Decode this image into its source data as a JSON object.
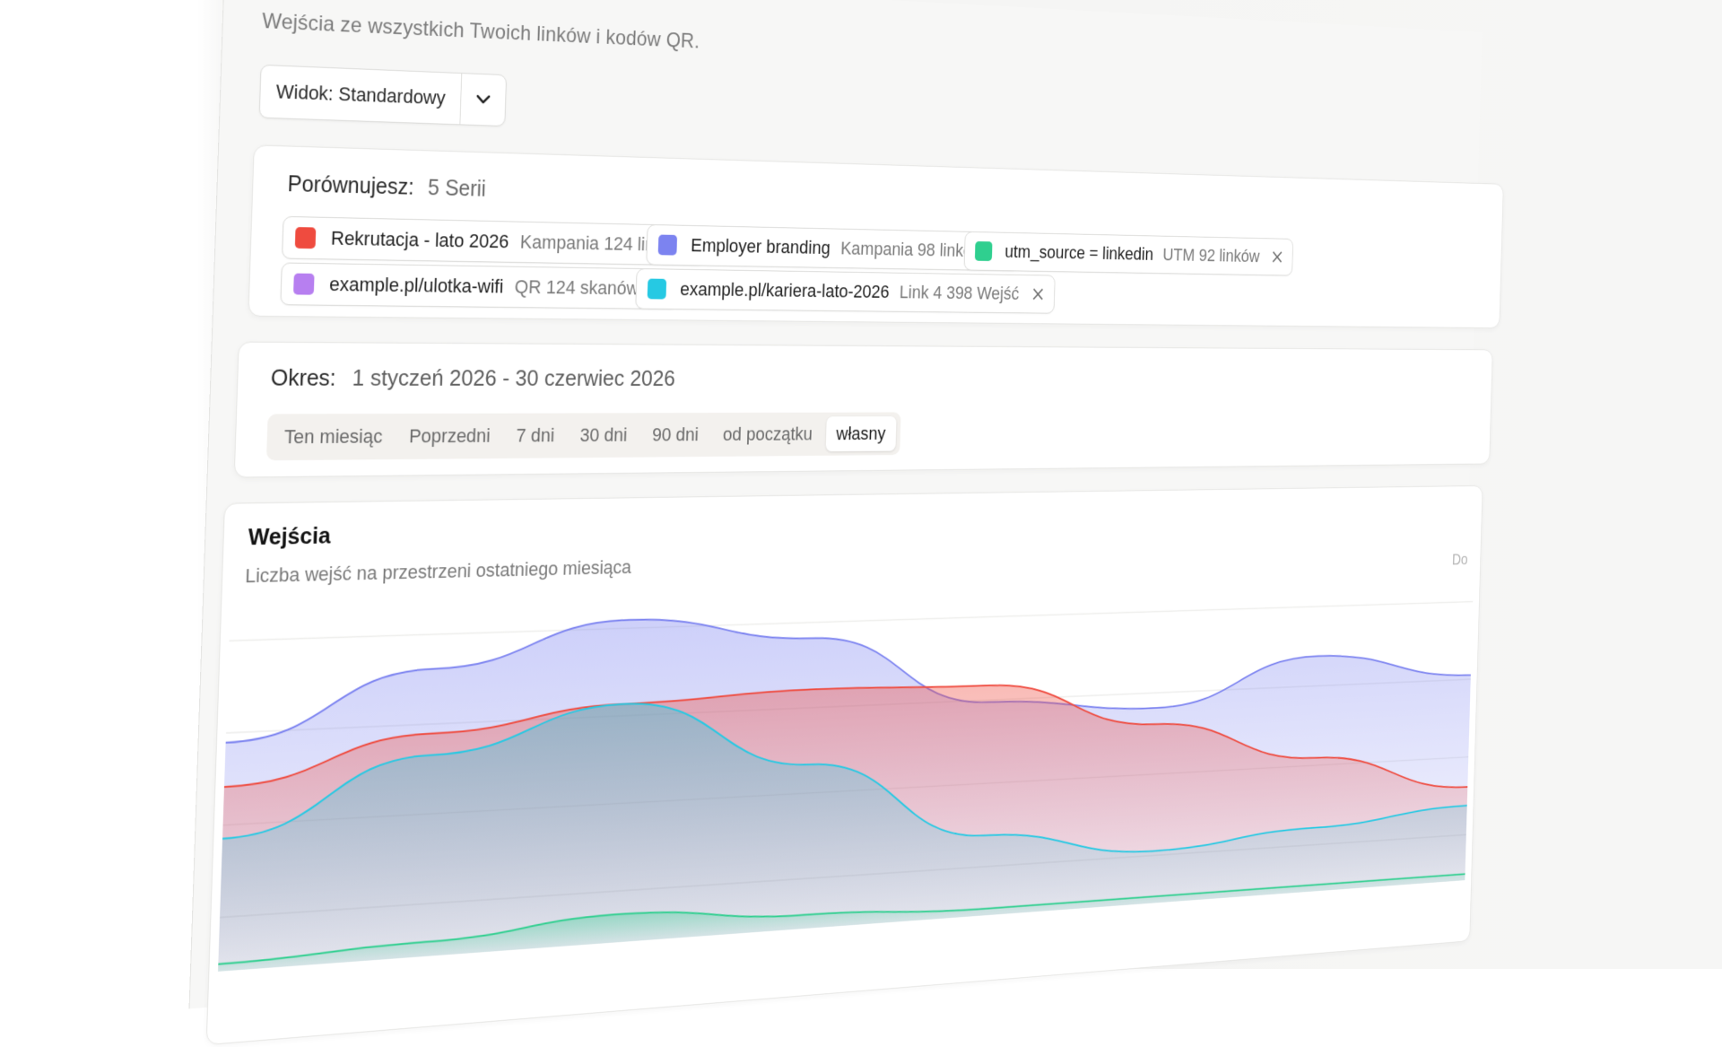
{
  "page": {
    "subtitle": "Wejścia ze wszystkich Twoich linków i kodów QR."
  },
  "view": {
    "label": "Widok: Standardowy",
    "caret_icon": "chevron-down-icon"
  },
  "compare": {
    "heading": "Porównujesz:",
    "count": "5 Serii",
    "chips": [
      {
        "name": "Rekrutacja - lato 2026",
        "meta": "Kampania 124 linki",
        "color": "#ef4b3f"
      },
      {
        "name": "Employer branding",
        "meta": "Kampania 98 linków",
        "color": "#7c83f0"
      },
      {
        "name": "utm_source = linkedin",
        "meta": "UTM 92 linków",
        "color": "#2fcf8f"
      },
      {
        "name": "example.pl/ulotka-wifi",
        "meta": "QR 124 skanów",
        "color": "#b77ff0"
      },
      {
        "name": "example.pl/kariera-lato-2026",
        "meta": "Link 4 398 Wejść",
        "color": "#26c9e3"
      }
    ]
  },
  "period": {
    "heading": "Okres:",
    "range": "1 styczeń 2026 - 30 czerwiec 2026",
    "options": [
      "Ten miesiąc",
      "Poprzedni",
      "7 dni",
      "30 dni",
      "90 dni",
      "od początku",
      "własny"
    ],
    "active_index": 6
  },
  "chart": {
    "title": "Wejścia",
    "subtitle": "Liczba wejść na przestrzeni ostatniego miesiąca",
    "right_label": "Do"
  },
  "chart_data": {
    "type": "area",
    "title": "Wejścia",
    "series": [
      {
        "name": "Employer branding",
        "color": "#7c83f0",
        "values": [
          62,
          80,
          92,
          85,
          64,
          60,
          74,
          66
        ]
      },
      {
        "name": "Rekrutacja - lato 2026",
        "color": "#ef4b3f",
        "values": [
          50,
          62,
          68,
          70,
          69,
          55,
          42,
          30
        ]
      },
      {
        "name": "example.pl/kariera-lato-2026",
        "color": "#26c9e3",
        "values": [
          36,
          56,
          68,
          48,
          24,
          16,
          20,
          24
        ]
      },
      {
        "name": "utm_source = linkedin",
        "color": "#2fcf8f",
        "values": [
          2,
          4,
          8,
          4,
          2,
          2,
          2,
          2
        ]
      }
    ],
    "ylim": [
      0,
      100
    ],
    "grid": true
  }
}
